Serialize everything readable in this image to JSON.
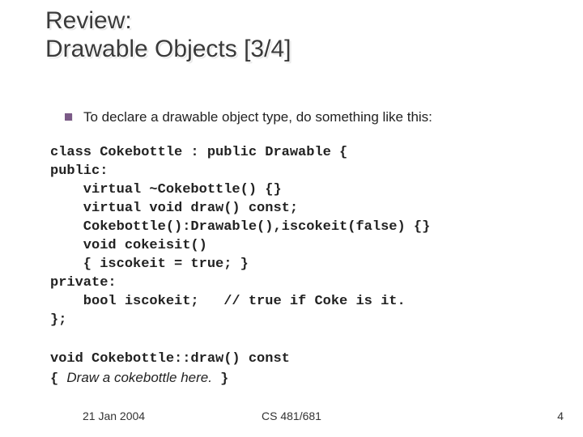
{
  "title_line1": "Review:",
  "title_line2": "Drawable Objects [3/4]",
  "bullet": "To declare a drawable object type, do something like this:",
  "code": {
    "l1": "class Cokebottle : public Drawable {",
    "l2": "public:",
    "l3": "    virtual ~Cokebottle() {}",
    "l4": "    virtual void draw() const;",
    "l5": "    Cokebottle():Drawable(),iscokeit(false) {}",
    "l6": "    void cokeisit()",
    "l7": "    { iscokeit = true; }",
    "l8": "private:",
    "l9": "    bool iscokeit;   // true if Coke is it.",
    "l10": "};"
  },
  "code2": {
    "l1": "void Cokebottle::draw() const",
    "l2_open": "{ ",
    "l2_italic": "Draw a cokebottle here.",
    "l2_close": " }"
  },
  "footer": {
    "date": "21 Jan 2004",
    "course": "CS 481/681",
    "page": "4"
  }
}
